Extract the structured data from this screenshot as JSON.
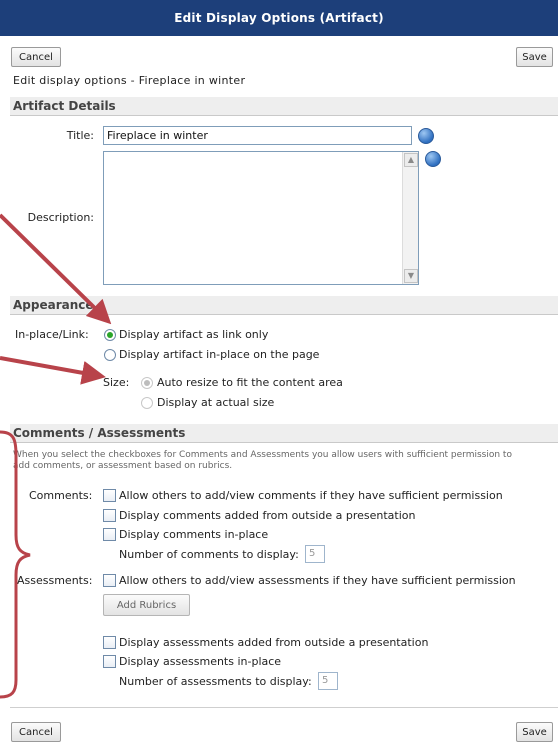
{
  "dialog": {
    "title": "Edit Display Options (Artifact)",
    "heading": "Edit display options - Fireplace in winter"
  },
  "toolbar": {
    "cancel_label": "Cancel",
    "save_label": "Save"
  },
  "artifact_details": {
    "section_title": "Artifact Details",
    "title_label": "Title:",
    "title_value": "Fireplace in winter",
    "description_label": "Description:",
    "description_value": ""
  },
  "appearance": {
    "section_title": "Appearance",
    "inplace_label": "In-place/Link:",
    "option_link": "Display artifact as link only",
    "option_inplace": "Display artifact in-place on the page",
    "selected": "link",
    "size_label": "Size:",
    "size_auto": "Auto resize to fit the content area",
    "size_actual": "Display at actual size"
  },
  "comments_assessments": {
    "section_title": "Comments / Assessments",
    "help_line1": "When you select the checkboxes for Comments and Assessments you allow users with sufficient permission to",
    "help_line2": "add comments, or assessment based on rubrics.",
    "comments_label": "Comments:",
    "comments_allow": "Allow others to add/view comments if they have sufficient permission",
    "comments_outside": "Display comments added from outside a presentation",
    "comments_inplace": "Display comments in-place",
    "comments_number_label": "Number of comments to display:",
    "comments_number_value": "5",
    "assessments_label": "Assessments:",
    "assessments_allow": "Allow others to add/view assessments if they have sufficient permission",
    "add_rubrics_label": "Add Rubrics",
    "assessments_outside": "Display assessments added from outside a presentation",
    "assessments_inplace": "Display assessments in-place",
    "assessments_number_label": "Number of assessments to display:",
    "assessments_number_value": "5"
  },
  "colors": {
    "titlebar": "#1d3f7a",
    "annotation_arrow": "#b8434a"
  },
  "icons": {
    "spellcheck": "spellcheck-icon",
    "arrows": "annotation-arrow",
    "brace": "annotation-brace"
  }
}
